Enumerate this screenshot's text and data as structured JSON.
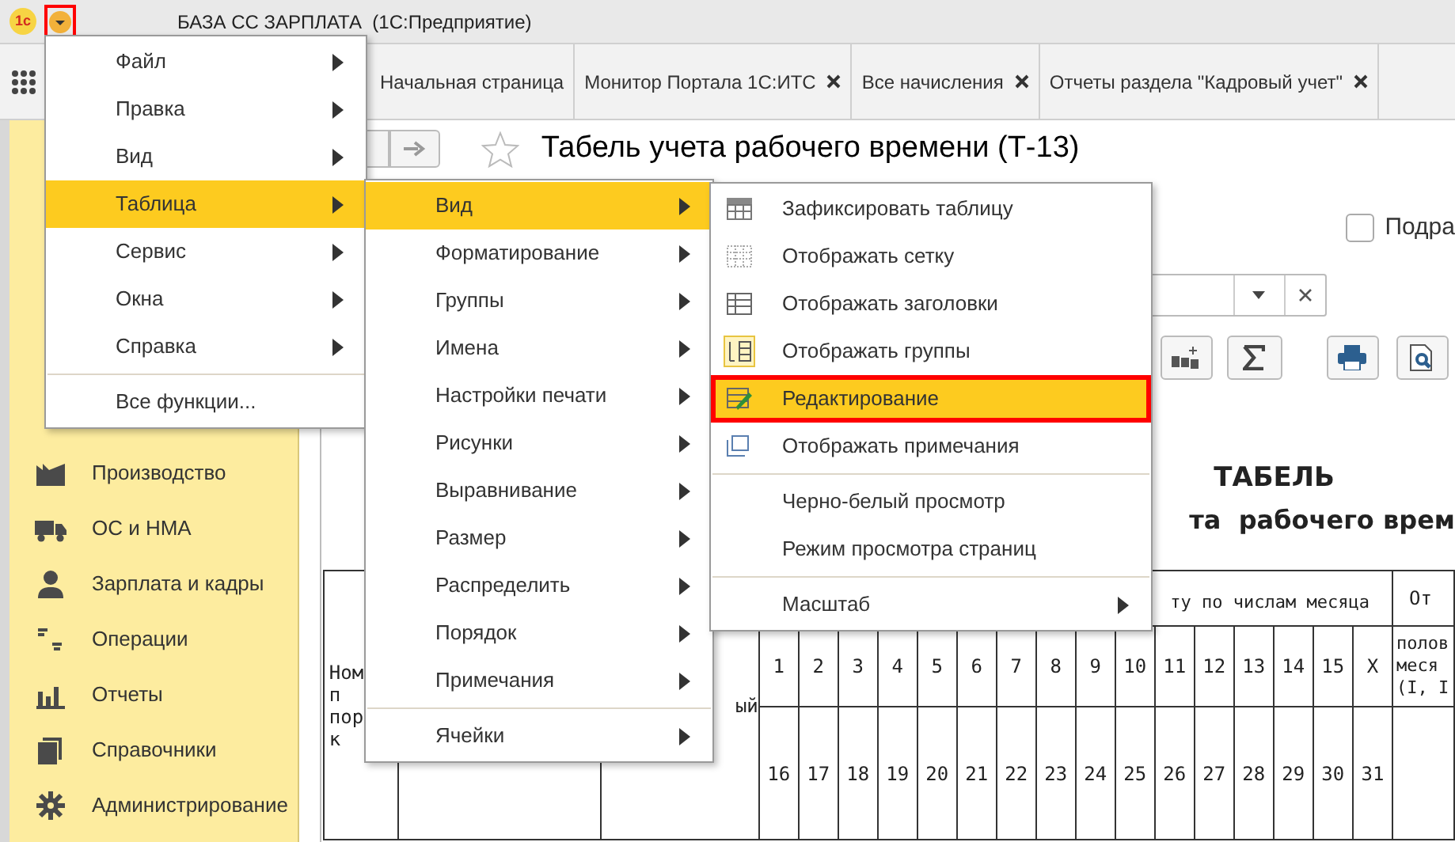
{
  "window": {
    "logo": "1с",
    "title": "БАЗА СС ЗАРПЛАТА  (1С:Предприятие)",
    "menu_button": {
      "highlighted": true
    }
  },
  "tabs": [
    {
      "label": "Начальная страница",
      "closable": false,
      "selected": false
    },
    {
      "label": "Монитор Портала 1С:ИТС",
      "closable": true,
      "selected": false
    },
    {
      "label": "Все начисления",
      "closable": true,
      "selected": false
    },
    {
      "label": "Отчеты раздела \"Кадровый учет\"",
      "closable": true,
      "selected": false
    }
  ],
  "sidebar": {
    "items": [
      {
        "label": "Производство",
        "kind": "factory"
      },
      {
        "label": "ОС и НМА",
        "kind": "truck"
      },
      {
        "label": "Зарплата и кадры",
        "kind": "person"
      },
      {
        "label": "Операции",
        "kind": "ledger"
      },
      {
        "label": "Отчеты",
        "kind": "chart"
      },
      {
        "label": "Справочники",
        "kind": "books"
      },
      {
        "label": "Администрирование",
        "kind": "gear"
      }
    ]
  },
  "form": {
    "title": "Табель учета рабочего времени (Т-13)",
    "favorite": false,
    "checkbox": {
      "label": "Подра",
      "checked": false
    }
  },
  "document": {
    "heading": "ТАБЕЛЬ",
    "subheading": "та  рабочего врем",
    "column_1": [
      "Ном",
      "п",
      "пор",
      "к"
    ],
    "column_3": "ый",
    "days_header": "ту по числам месяца",
    "column_right_header": "От",
    "column_right": [
      "полов",
      "меся",
      "(I, I"
    ],
    "days_row_1": [
      "1",
      "2",
      "3",
      "4",
      "5",
      "6",
      "7",
      "8",
      "9",
      "10",
      "11",
      "12",
      "13",
      "14",
      "15",
      "X"
    ],
    "days_row_2": [
      "16",
      "17",
      "18",
      "19",
      "20",
      "21",
      "22",
      "23",
      "24",
      "25",
      "26",
      "27",
      "28",
      "29",
      "30",
      "31"
    ]
  },
  "main_menu": {
    "items": [
      {
        "label": "Файл",
        "submenu": true,
        "selected": false
      },
      {
        "label": "Правка",
        "submenu": true,
        "selected": false
      },
      {
        "label": "Вид",
        "submenu": true,
        "selected": false
      },
      {
        "label": "Таблица",
        "submenu": true,
        "selected": true
      },
      {
        "label": "Сервис",
        "submenu": true,
        "selected": false
      },
      {
        "label": "Окна",
        "submenu": true,
        "selected": false
      },
      {
        "label": "Справка",
        "submenu": true,
        "selected": false
      },
      {
        "label": "Все функции...",
        "submenu": false,
        "selected": false,
        "separator_before": true
      }
    ]
  },
  "table_menu": {
    "items": [
      {
        "label": "Вид",
        "submenu": true,
        "selected": true
      },
      {
        "label": "Форматирование",
        "submenu": true,
        "selected": false
      },
      {
        "label": "Группы",
        "submenu": true,
        "selected": false
      },
      {
        "label": "Имена",
        "submenu": true,
        "selected": false
      },
      {
        "label": "Настройки печати",
        "submenu": true,
        "selected": false
      },
      {
        "label": "Рисунки",
        "submenu": true,
        "selected": false
      },
      {
        "label": "Выравнивание",
        "submenu": true,
        "selected": false
      },
      {
        "label": "Размер",
        "submenu": true,
        "selected": false
      },
      {
        "label": "Распределить",
        "submenu": true,
        "selected": false
      },
      {
        "label": "Порядок",
        "submenu": true,
        "selected": false
      },
      {
        "label": "Примечания",
        "submenu": true,
        "selected": false
      },
      {
        "label": "Ячейки",
        "submenu": true,
        "selected": false,
        "separator_before": true
      }
    ]
  },
  "view_menu": {
    "items": [
      {
        "label": "Зафиксировать таблицу",
        "kind": "freeze",
        "checked": false,
        "selected": false,
        "highlighted": false
      },
      {
        "label": "Отображать сетку",
        "kind": "grid",
        "checked": false,
        "selected": false,
        "highlighted": false
      },
      {
        "label": "Отображать заголовки",
        "kind": "headers",
        "checked": false,
        "selected": false,
        "highlighted": false
      },
      {
        "label": "Отображать группы",
        "kind": "groups",
        "checked": true,
        "selected": false,
        "highlighted": false
      },
      {
        "label": "Редактирование",
        "kind": "edit",
        "checked": false,
        "selected": true,
        "highlighted": true
      },
      {
        "label": "Отображать примечания",
        "kind": "notes",
        "checked": false,
        "selected": false,
        "highlighted": false
      },
      {
        "label": "Черно-белый просмотр",
        "kind": "plain",
        "selected": false,
        "highlighted": false,
        "separator_before": true
      },
      {
        "label": "Режим просмотра страниц",
        "kind": "plain",
        "selected": false,
        "highlighted": false
      },
      {
        "label": "Масштаб",
        "kind": "submenu",
        "selected": false,
        "highlighted": false,
        "separator_before": true
      }
    ]
  }
}
